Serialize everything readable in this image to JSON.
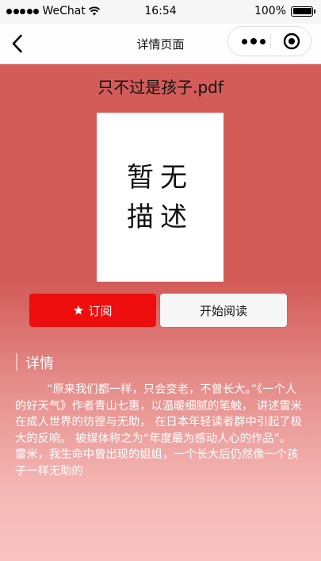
{
  "status_bar": {
    "carrier": "WeChat",
    "time": "16:54",
    "battery": "100%"
  },
  "nav": {
    "title": "详情页面"
  },
  "document": {
    "file_name": "只不过是孩子.pdf",
    "cover_text": [
      "暂无",
      "描述"
    ]
  },
  "actions": {
    "subscribe_label": "订阅",
    "read_label": "开始阅读"
  },
  "details": {
    "heading": "详情",
    "description": "“原来我们都一样，只会变老，不曾长大。”《一个人的好天气》作者青山七惠，以温暖细腻的笔触， 讲述雷米在成人世界的彷徨与无助， 在日本年轻读者群中引起了极大的反响。 被媒体称之为“年度最为感动人心的作品”。 雷米，我生命中曾出现的姐姐，一个长大后仍然像一个孩子一样无助的"
  }
}
